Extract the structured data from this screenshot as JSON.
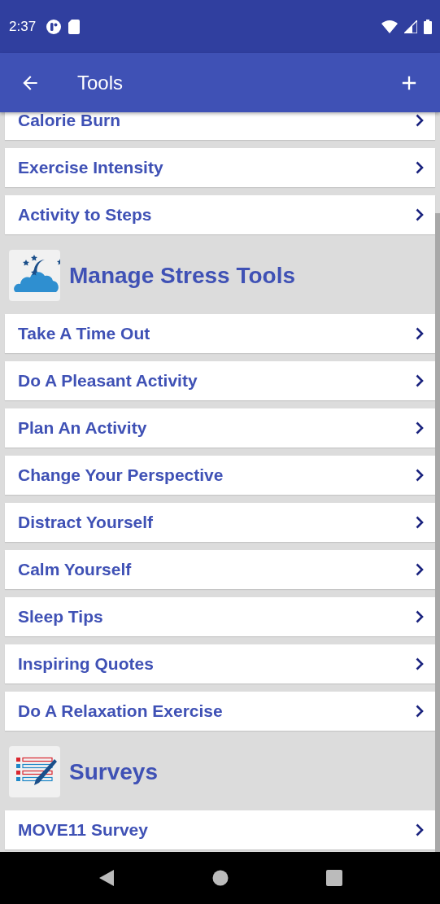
{
  "status_bar": {
    "time": "2:37"
  },
  "app_bar": {
    "title": "Tools"
  },
  "list": [
    {
      "kind": "item",
      "label": "Calorie Burn"
    },
    {
      "kind": "item",
      "label": "Exercise Intensity"
    },
    {
      "kind": "item",
      "label": "Activity to Steps"
    },
    {
      "kind": "header",
      "label": "Manage Stress Tools"
    },
    {
      "kind": "item",
      "label": "Take A Time Out"
    },
    {
      "kind": "item",
      "label": "Do A Pleasant Activity"
    },
    {
      "kind": "item",
      "label": "Plan An Activity"
    },
    {
      "kind": "item",
      "label": "Change Your Perspective"
    },
    {
      "kind": "item",
      "label": "Distract Yourself"
    },
    {
      "kind": "item",
      "label": "Calm Yourself"
    },
    {
      "kind": "item",
      "label": "Sleep Tips"
    },
    {
      "kind": "item",
      "label": "Inspiring Quotes"
    },
    {
      "kind": "item",
      "label": "Do A Relaxation Exercise"
    },
    {
      "kind": "header",
      "label": "Surveys"
    },
    {
      "kind": "item",
      "label": "MOVE11 Survey"
    }
  ]
}
